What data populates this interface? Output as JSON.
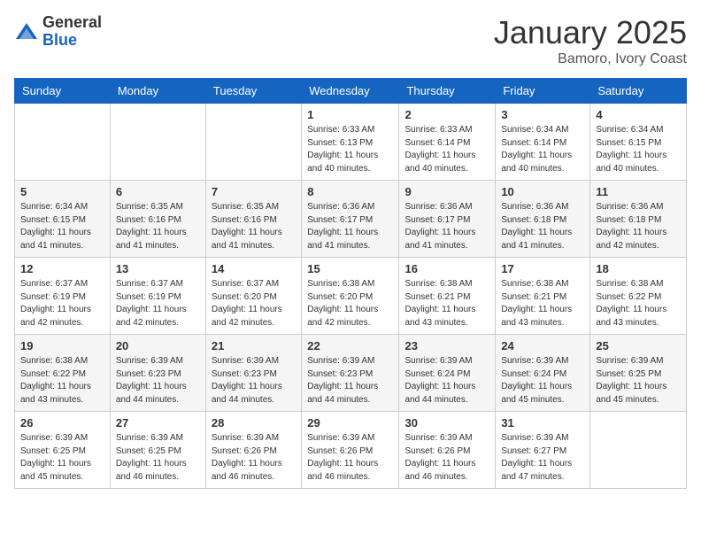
{
  "header": {
    "logo_general": "General",
    "logo_blue": "Blue",
    "month": "January 2025",
    "location": "Bamoro, Ivory Coast"
  },
  "days_of_week": [
    "Sunday",
    "Monday",
    "Tuesday",
    "Wednesday",
    "Thursday",
    "Friday",
    "Saturday"
  ],
  "weeks": [
    [
      {
        "day": "",
        "info": ""
      },
      {
        "day": "",
        "info": ""
      },
      {
        "day": "",
        "info": ""
      },
      {
        "day": "1",
        "info": "Sunrise: 6:33 AM\nSunset: 6:13 PM\nDaylight: 11 hours\nand 40 minutes."
      },
      {
        "day": "2",
        "info": "Sunrise: 6:33 AM\nSunset: 6:14 PM\nDaylight: 11 hours\nand 40 minutes."
      },
      {
        "day": "3",
        "info": "Sunrise: 6:34 AM\nSunset: 6:14 PM\nDaylight: 11 hours\nand 40 minutes."
      },
      {
        "day": "4",
        "info": "Sunrise: 6:34 AM\nSunset: 6:15 PM\nDaylight: 11 hours\nand 40 minutes."
      }
    ],
    [
      {
        "day": "5",
        "info": "Sunrise: 6:34 AM\nSunset: 6:15 PM\nDaylight: 11 hours\nand 41 minutes."
      },
      {
        "day": "6",
        "info": "Sunrise: 6:35 AM\nSunset: 6:16 PM\nDaylight: 11 hours\nand 41 minutes."
      },
      {
        "day": "7",
        "info": "Sunrise: 6:35 AM\nSunset: 6:16 PM\nDaylight: 11 hours\nand 41 minutes."
      },
      {
        "day": "8",
        "info": "Sunrise: 6:36 AM\nSunset: 6:17 PM\nDaylight: 11 hours\nand 41 minutes."
      },
      {
        "day": "9",
        "info": "Sunrise: 6:36 AM\nSunset: 6:17 PM\nDaylight: 11 hours\nand 41 minutes."
      },
      {
        "day": "10",
        "info": "Sunrise: 6:36 AM\nSunset: 6:18 PM\nDaylight: 11 hours\nand 41 minutes."
      },
      {
        "day": "11",
        "info": "Sunrise: 6:36 AM\nSunset: 6:18 PM\nDaylight: 11 hours\nand 42 minutes."
      }
    ],
    [
      {
        "day": "12",
        "info": "Sunrise: 6:37 AM\nSunset: 6:19 PM\nDaylight: 11 hours\nand 42 minutes."
      },
      {
        "day": "13",
        "info": "Sunrise: 6:37 AM\nSunset: 6:19 PM\nDaylight: 11 hours\nand 42 minutes."
      },
      {
        "day": "14",
        "info": "Sunrise: 6:37 AM\nSunset: 6:20 PM\nDaylight: 11 hours\nand 42 minutes."
      },
      {
        "day": "15",
        "info": "Sunrise: 6:38 AM\nSunset: 6:20 PM\nDaylight: 11 hours\nand 42 minutes."
      },
      {
        "day": "16",
        "info": "Sunrise: 6:38 AM\nSunset: 6:21 PM\nDaylight: 11 hours\nand 43 minutes."
      },
      {
        "day": "17",
        "info": "Sunrise: 6:38 AM\nSunset: 6:21 PM\nDaylight: 11 hours\nand 43 minutes."
      },
      {
        "day": "18",
        "info": "Sunrise: 6:38 AM\nSunset: 6:22 PM\nDaylight: 11 hours\nand 43 minutes."
      }
    ],
    [
      {
        "day": "19",
        "info": "Sunrise: 6:38 AM\nSunset: 6:22 PM\nDaylight: 11 hours\nand 43 minutes."
      },
      {
        "day": "20",
        "info": "Sunrise: 6:39 AM\nSunset: 6:23 PM\nDaylight: 11 hours\nand 44 minutes."
      },
      {
        "day": "21",
        "info": "Sunrise: 6:39 AM\nSunset: 6:23 PM\nDaylight: 11 hours\nand 44 minutes."
      },
      {
        "day": "22",
        "info": "Sunrise: 6:39 AM\nSunset: 6:23 PM\nDaylight: 11 hours\nand 44 minutes."
      },
      {
        "day": "23",
        "info": "Sunrise: 6:39 AM\nSunset: 6:24 PM\nDaylight: 11 hours\nand 44 minutes."
      },
      {
        "day": "24",
        "info": "Sunrise: 6:39 AM\nSunset: 6:24 PM\nDaylight: 11 hours\nand 45 minutes."
      },
      {
        "day": "25",
        "info": "Sunrise: 6:39 AM\nSunset: 6:25 PM\nDaylight: 11 hours\nand 45 minutes."
      }
    ],
    [
      {
        "day": "26",
        "info": "Sunrise: 6:39 AM\nSunset: 6:25 PM\nDaylight: 11 hours\nand 45 minutes."
      },
      {
        "day": "27",
        "info": "Sunrise: 6:39 AM\nSunset: 6:25 PM\nDaylight: 11 hours\nand 46 minutes."
      },
      {
        "day": "28",
        "info": "Sunrise: 6:39 AM\nSunset: 6:26 PM\nDaylight: 11 hours\nand 46 minutes."
      },
      {
        "day": "29",
        "info": "Sunrise: 6:39 AM\nSunset: 6:26 PM\nDaylight: 11 hours\nand 46 minutes."
      },
      {
        "day": "30",
        "info": "Sunrise: 6:39 AM\nSunset: 6:26 PM\nDaylight: 11 hours\nand 46 minutes."
      },
      {
        "day": "31",
        "info": "Sunrise: 6:39 AM\nSunset: 6:27 PM\nDaylight: 11 hours\nand 47 minutes."
      },
      {
        "day": "",
        "info": ""
      }
    ]
  ]
}
